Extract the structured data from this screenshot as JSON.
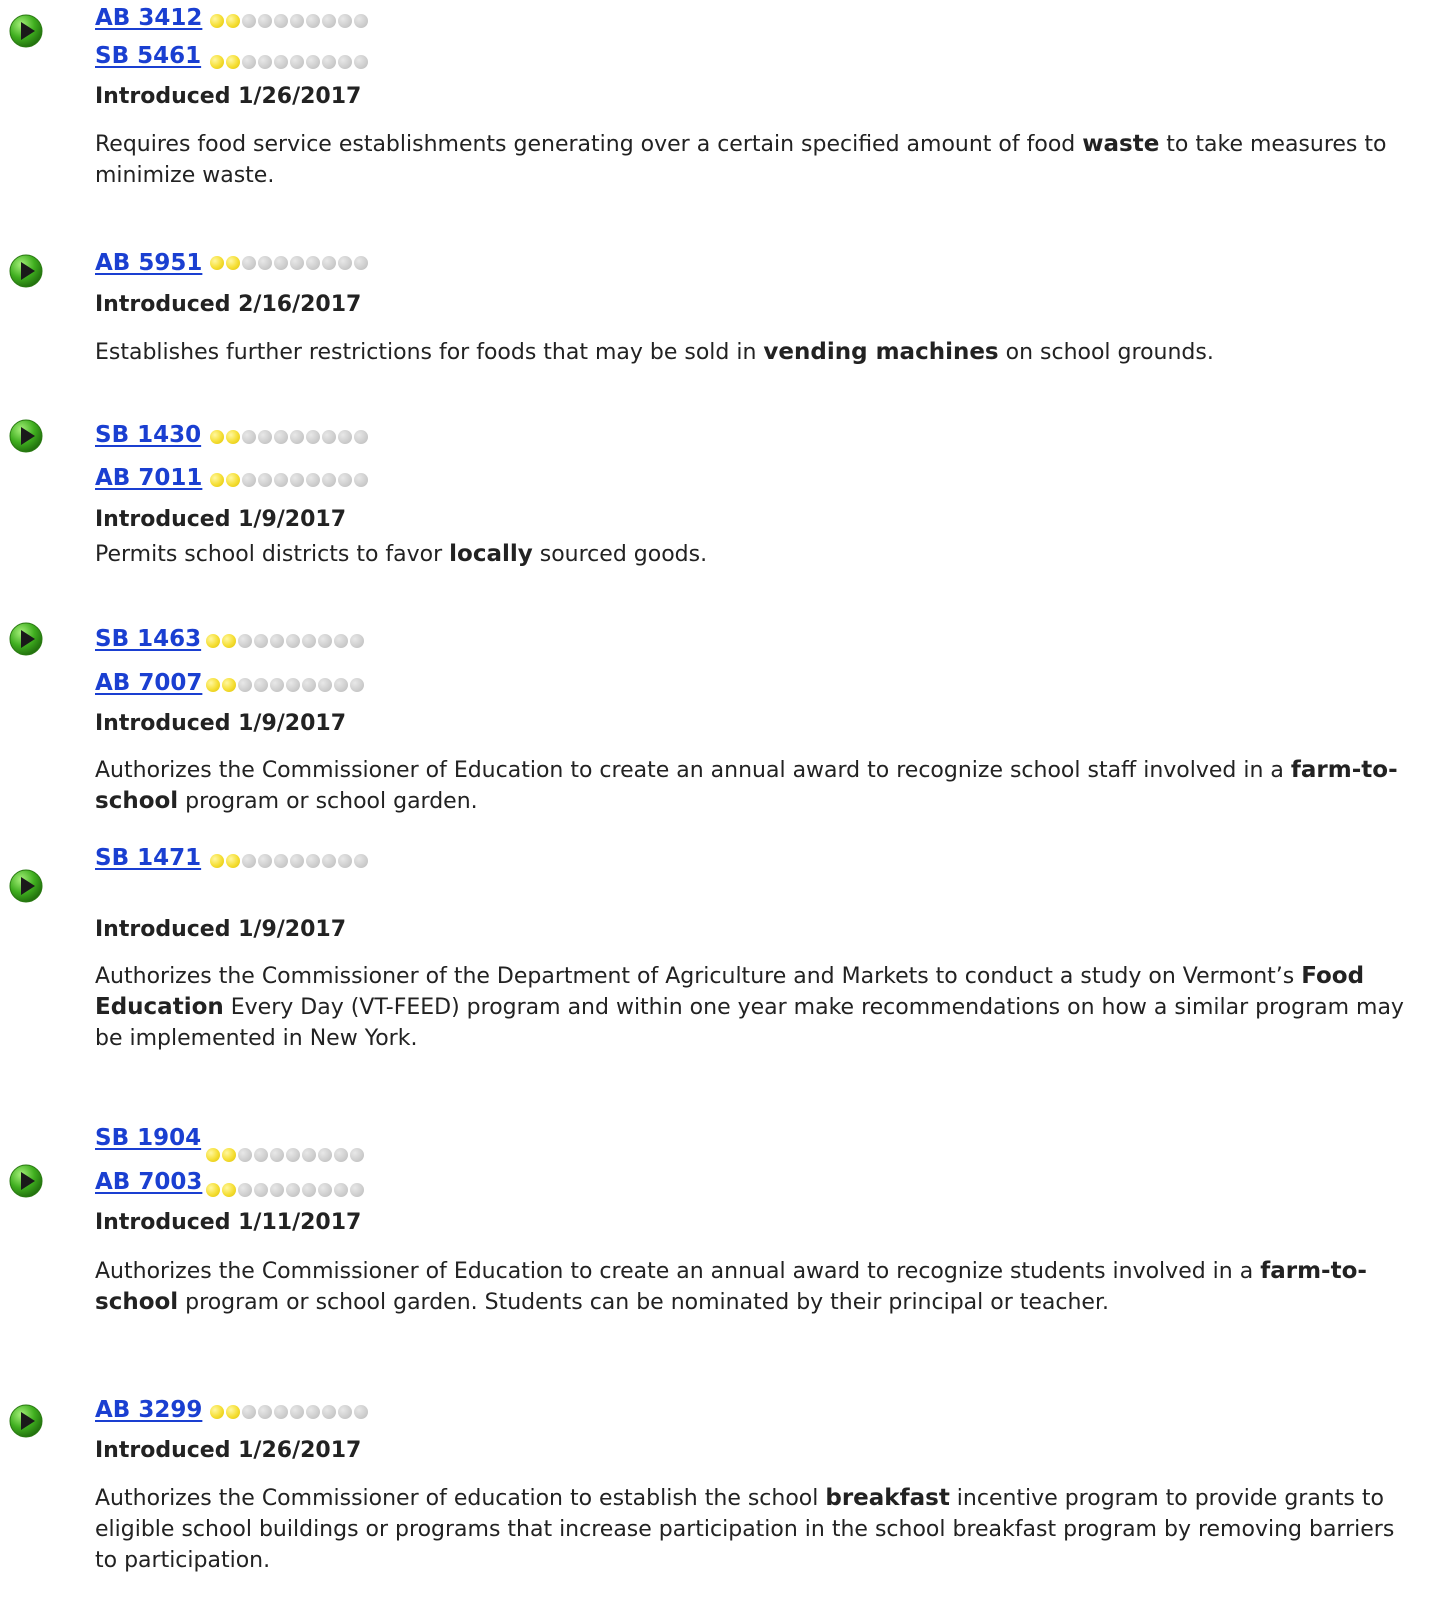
{
  "bills": [
    {
      "links": [
        {
          "label": "AB 3412",
          "progress_filled": 2,
          "progress_total": 10
        },
        {
          "label": "SB 5461",
          "progress_filled": 2,
          "progress_total": 10
        }
      ],
      "introduced": "Introduced 1/26/2017",
      "description": {
        "before": "Requires food service establishments generating over a certain specified amount of food ",
        "keyword": "waste",
        "after": " to take measures to minimize waste."
      }
    },
    {
      "links": [
        {
          "label": "AB 5951",
          "progress_filled": 2,
          "progress_total": 10
        }
      ],
      "introduced": "Introduced 2/16/2017",
      "description": {
        "before": "Establishes further restrictions for foods that may be sold in ",
        "keyword": "vending machines",
        "after": " on school grounds."
      }
    },
    {
      "links": [
        {
          "label": "SB 1430",
          "progress_filled": 2,
          "progress_total": 10
        },
        {
          "label": "AB 7011",
          "progress_filled": 2,
          "progress_total": 10
        }
      ],
      "introduced": "Introduced 1/9/2017",
      "description": {
        "before": "Permits school districts to favor ",
        "keyword": "locally",
        "after": " sourced goods."
      }
    },
    {
      "links": [
        {
          "label": "SB 1463",
          "progress_filled": 2,
          "progress_total": 10
        },
        {
          "label": "AB 7007",
          "progress_filled": 2,
          "progress_total": 10
        }
      ],
      "introduced": "Introduced 1/9/2017",
      "description": {
        "before": "Authorizes the Commissioner of Education to create an annual award to recognize school staff involved in a ",
        "keyword": "farm-to-school",
        "after": " program or school garden."
      }
    },
    {
      "links": [
        {
          "label": "SB 1471",
          "progress_filled": 2,
          "progress_total": 10
        }
      ],
      "introduced": "Introduced 1/9/2017",
      "description": {
        "before": "Authorizes the Commissioner of the Department of Agriculture and Markets to conduct a study on Vermont’s ",
        "keyword": "Food Education",
        "after": " Every Day (VT-FEED) program and within one year make recommendations on how a similar program may be implemented in New York."
      }
    },
    {
      "links": [
        {
          "label": "SB 1904",
          "progress_filled": 2,
          "progress_total": 10
        },
        {
          "label": "AB 7003",
          "progress_filled": 2,
          "progress_total": 10
        }
      ],
      "introduced": "Introduced 1/11/2017",
      "description": {
        "before": "Authorizes the Commissioner of Education to create an annual award to recognize students involved in a ",
        "keyword": "farm-to-school",
        "after": " program or school garden. Students can be nominated by their principal or teacher."
      }
    },
    {
      "links": [
        {
          "label": "AB 3299",
          "progress_filled": 2,
          "progress_total": 10
        }
      ],
      "introduced": "Introduced 1/26/2017",
      "description": {
        "before": "Authorizes the Commissioner of education to establish the school ",
        "keyword": "breakfast",
        "after": " incentive program to provide grants to eligible school buildings or programs that increase participation in the school breakfast program by removing barriers to participation."
      }
    }
  ],
  "colors": {
    "link": "#1a3fd1",
    "play_icon": "#3fae1f",
    "dot_on": "#f6e03a",
    "dot_off": "#cfcfcf"
  },
  "icons": {
    "play": "play-icon"
  }
}
